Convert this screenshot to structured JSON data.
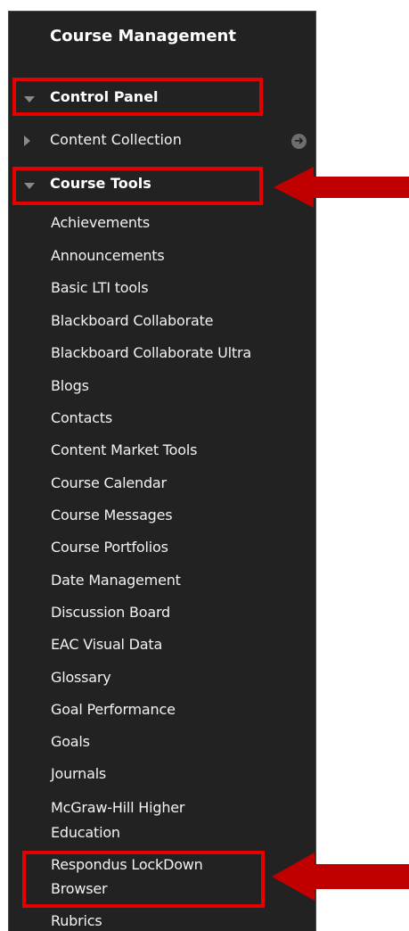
{
  "panel": {
    "title": "Course Management",
    "control_panel": "Control Panel",
    "content_collection": "Content Collection",
    "course_tools": "Course Tools",
    "tools": [
      "Achievements",
      "Announcements",
      "Basic LTI tools",
      "Blackboard Collaborate",
      "Blackboard Collaborate Ultra",
      "Blogs",
      "Contacts",
      "Content Market Tools",
      "Course Calendar",
      "Course Messages",
      "Course Portfolios",
      "Date Management",
      "Discussion Board",
      "EAC Visual Data",
      "Glossary",
      "Goal Performance",
      "Goals",
      "Journals",
      "McGraw-Hill Higher",
      "Education",
      "Respondus LockDown",
      "Browser",
      "Rubrics"
    ]
  },
  "colors": {
    "panel_bg": "#222222",
    "highlight": "#e60000",
    "arrow": "#c00000"
  },
  "icons": [
    "caret-down-icon",
    "caret-right-icon",
    "arrow-right-circle-icon",
    "red-arrow-left-icon"
  ]
}
